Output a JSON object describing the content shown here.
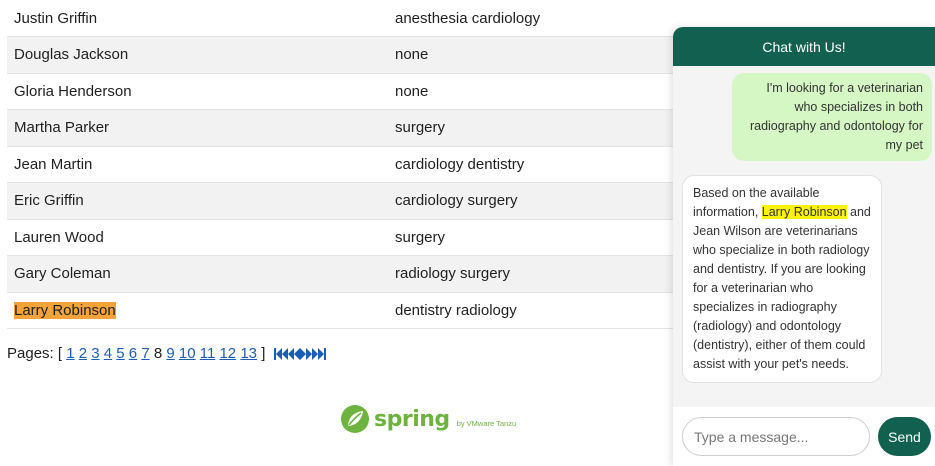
{
  "vets": {
    "rows": [
      {
        "name": "Justin Griffin",
        "specialties": "anesthesia cardiology"
      },
      {
        "name": "Douglas Jackson",
        "specialties": "none"
      },
      {
        "name": "Gloria Henderson",
        "specialties": "none"
      },
      {
        "name": "Martha Parker",
        "specialties": "surgery"
      },
      {
        "name": "Jean Martin",
        "specialties": "cardiology dentistry"
      },
      {
        "name": "Eric Griffin",
        "specialties": "cardiology surgery"
      },
      {
        "name": "Lauren Wood",
        "specialties": "surgery"
      },
      {
        "name": "Gary Coleman",
        "specialties": "radiology surgery"
      },
      {
        "name": "Larry Robinson",
        "specialties": "dentistry radiology"
      }
    ],
    "highlighted_row": "Larry Robinson",
    "highlight_color": "#f3a33a"
  },
  "pagination": {
    "label": "Pages:",
    "open_bracket": "[",
    "close_bracket": "]",
    "pages": [
      "1",
      "2",
      "3",
      "4",
      "5",
      "6",
      "7",
      "8",
      "9",
      "10",
      "11",
      "12",
      "13"
    ],
    "current_page": "8",
    "nav_icons": [
      "first-page-icon",
      "previous-page-icon",
      "next-page-icon",
      "last-page-icon"
    ],
    "link_color": "#1a5fb4"
  },
  "footer": {
    "logo_word": "spring",
    "logo_sub": "by VMware Tanzu",
    "logo_color": "#6db33f"
  },
  "chat": {
    "title": "Chat with Us!",
    "header_color": "#126150",
    "user_message": "I'm looking for a veterinarian who specializes in both radiography and odontology for my pet",
    "bot_message": {
      "before": "Based on the available information, ",
      "highlight": "Larry Robinson",
      "after": " and Jean Wilson are veterinarians who specialize in both radiology and dentistry. If you are looking for a veterinarian who specializes in radiography (radiology) and odontology (dentistry), either of them could assist with your pet's needs."
    },
    "input_placeholder": "Type a message...",
    "input_value": "",
    "send_label": "Send"
  }
}
